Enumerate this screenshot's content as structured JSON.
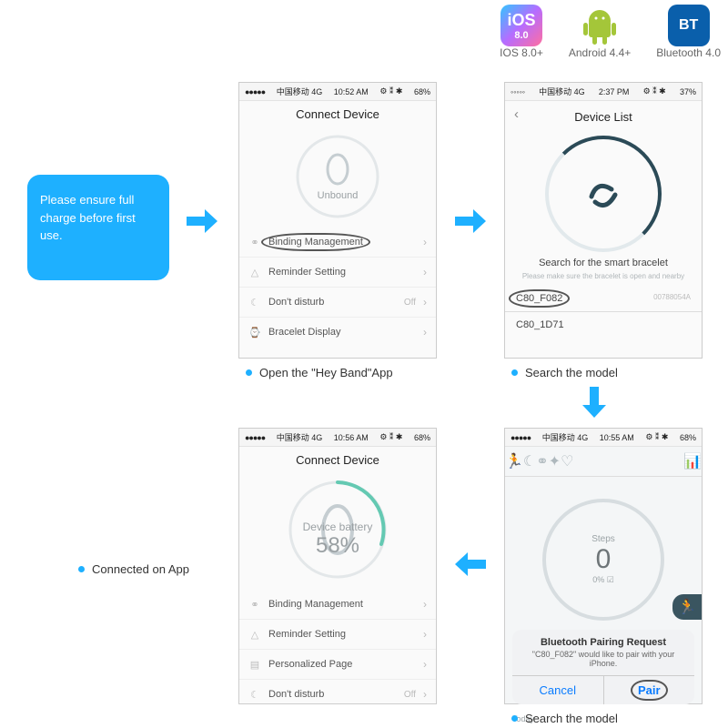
{
  "compat": {
    "ios": {
      "badge": "iOS",
      "badge_sub": "8.0",
      "label": "IOS 8.0+"
    },
    "android": {
      "label": "Android 4.4+"
    },
    "bt": {
      "badge": "BT",
      "label": "Bluetooth 4.0"
    }
  },
  "instruction": "Please ensure full charge before first use.",
  "step1": {
    "carrier": "中国移动  4G",
    "time": "10:52 AM",
    "batt": "68%",
    "title": "Connect Device",
    "unbound": "Unbound",
    "rows": {
      "binding": "Binding Management",
      "reminder": "Reminder Setting",
      "dnd": "Don't disturb",
      "dnd_val": "Off",
      "display": "Bracelet Display"
    },
    "caption": "Open the \"Hey Band\"App"
  },
  "step2": {
    "carrier": "中国移动  4G",
    "time": "2:37 PM",
    "batt": "37%",
    "title": "Device List",
    "search": "Search for the smart bracelet",
    "hint": "Please make sure the bracelet is open and nearby",
    "dev1": "C80_F082",
    "dev1_sub": "00788054A",
    "dev2": "C80_1D71",
    "caption": "Search the model"
  },
  "step3": {
    "carrier": "中国移动  4G",
    "time": "10:56 AM",
    "batt": "68%",
    "title": "Connect Device",
    "batt_label": "Device battery",
    "batt_pct": "58%",
    "rows": {
      "binding": "Binding Management",
      "reminder": "Reminder Setting",
      "personal": "Personalized Page",
      "dnd": "Don't disturb",
      "dnd_val": "Off"
    }
  },
  "step4": {
    "carrier": "中国移动  4G",
    "time": "10:55 AM",
    "batt": "68%",
    "steps_label": "Steps",
    "steps_val": "0",
    "steps_pct": "0% ☑",
    "popup_title": "Bluetooth Pairing Request",
    "popup_msg": "\"C80_F082\" would like to pair with your iPhone.",
    "cancel": "Cancel",
    "pair": "Pair",
    "today": "Today",
    "caption": "Search the model"
  },
  "connected_caption": "Connected on App"
}
